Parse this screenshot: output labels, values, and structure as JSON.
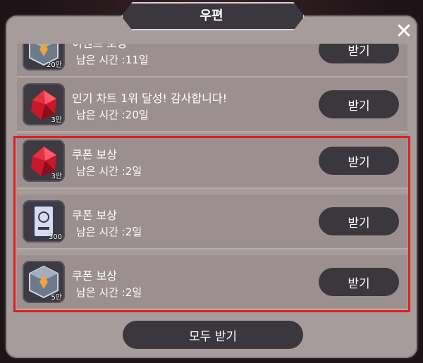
{
  "window": {
    "title": "우편"
  },
  "mails": [
    {
      "title": "이벤트 보상",
      "time": "남은 시간 :11일",
      "qty": "20만",
      "item": "dice-box",
      "claim_label": "받기"
    },
    {
      "title": "인기 차트 1위 달성! 감사합니다!",
      "time": "남은 시간 :20일",
      "qty": "3만",
      "item": "red-gem",
      "claim_label": "받기"
    },
    {
      "title": "쿠폰 보상",
      "time": "남은 시간 :2일",
      "qty": "3만",
      "item": "red-gem",
      "claim_label": "받기"
    },
    {
      "title": "쿠폰 보상",
      "time": "남은 시간 :2일",
      "qty": "300",
      "item": "card",
      "claim_label": "받기"
    },
    {
      "title": "쿠폰 보상",
      "time": "남은 시간 :2일",
      "qty": "5만",
      "item": "dice-box",
      "claim_label": "받기"
    }
  ],
  "footer": {
    "claim_all_label": "모두 받기"
  },
  "colors": {
    "highlight": "#e11d1d",
    "panel": "#a79c9c",
    "button": "#3a373d"
  }
}
